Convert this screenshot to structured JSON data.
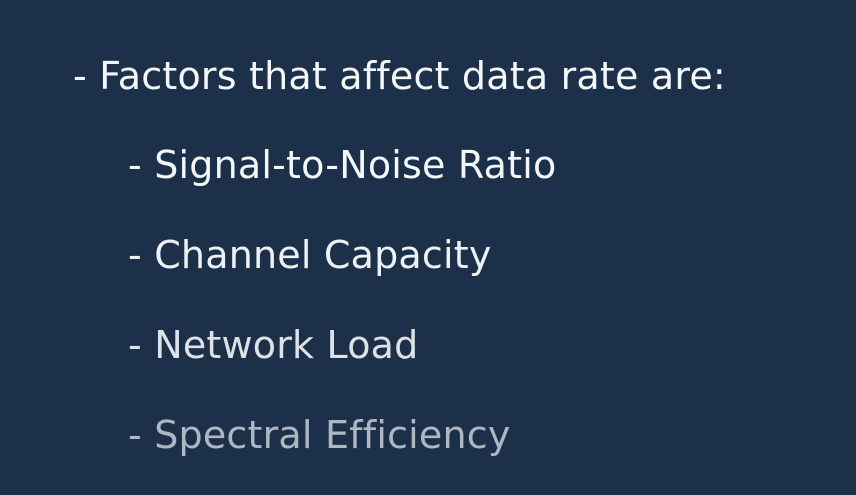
{
  "slide": {
    "heading": "- Factors that affect data rate are:",
    "items": [
      "- Signal-to-Noise Ratio",
      "- Channel Capacity",
      "- Network Load",
      "- Spectral Efficiency"
    ]
  },
  "colors": {
    "background": "#1c3049",
    "text": "#f4f6f8",
    "faded_text": "#aeb7c2"
  }
}
